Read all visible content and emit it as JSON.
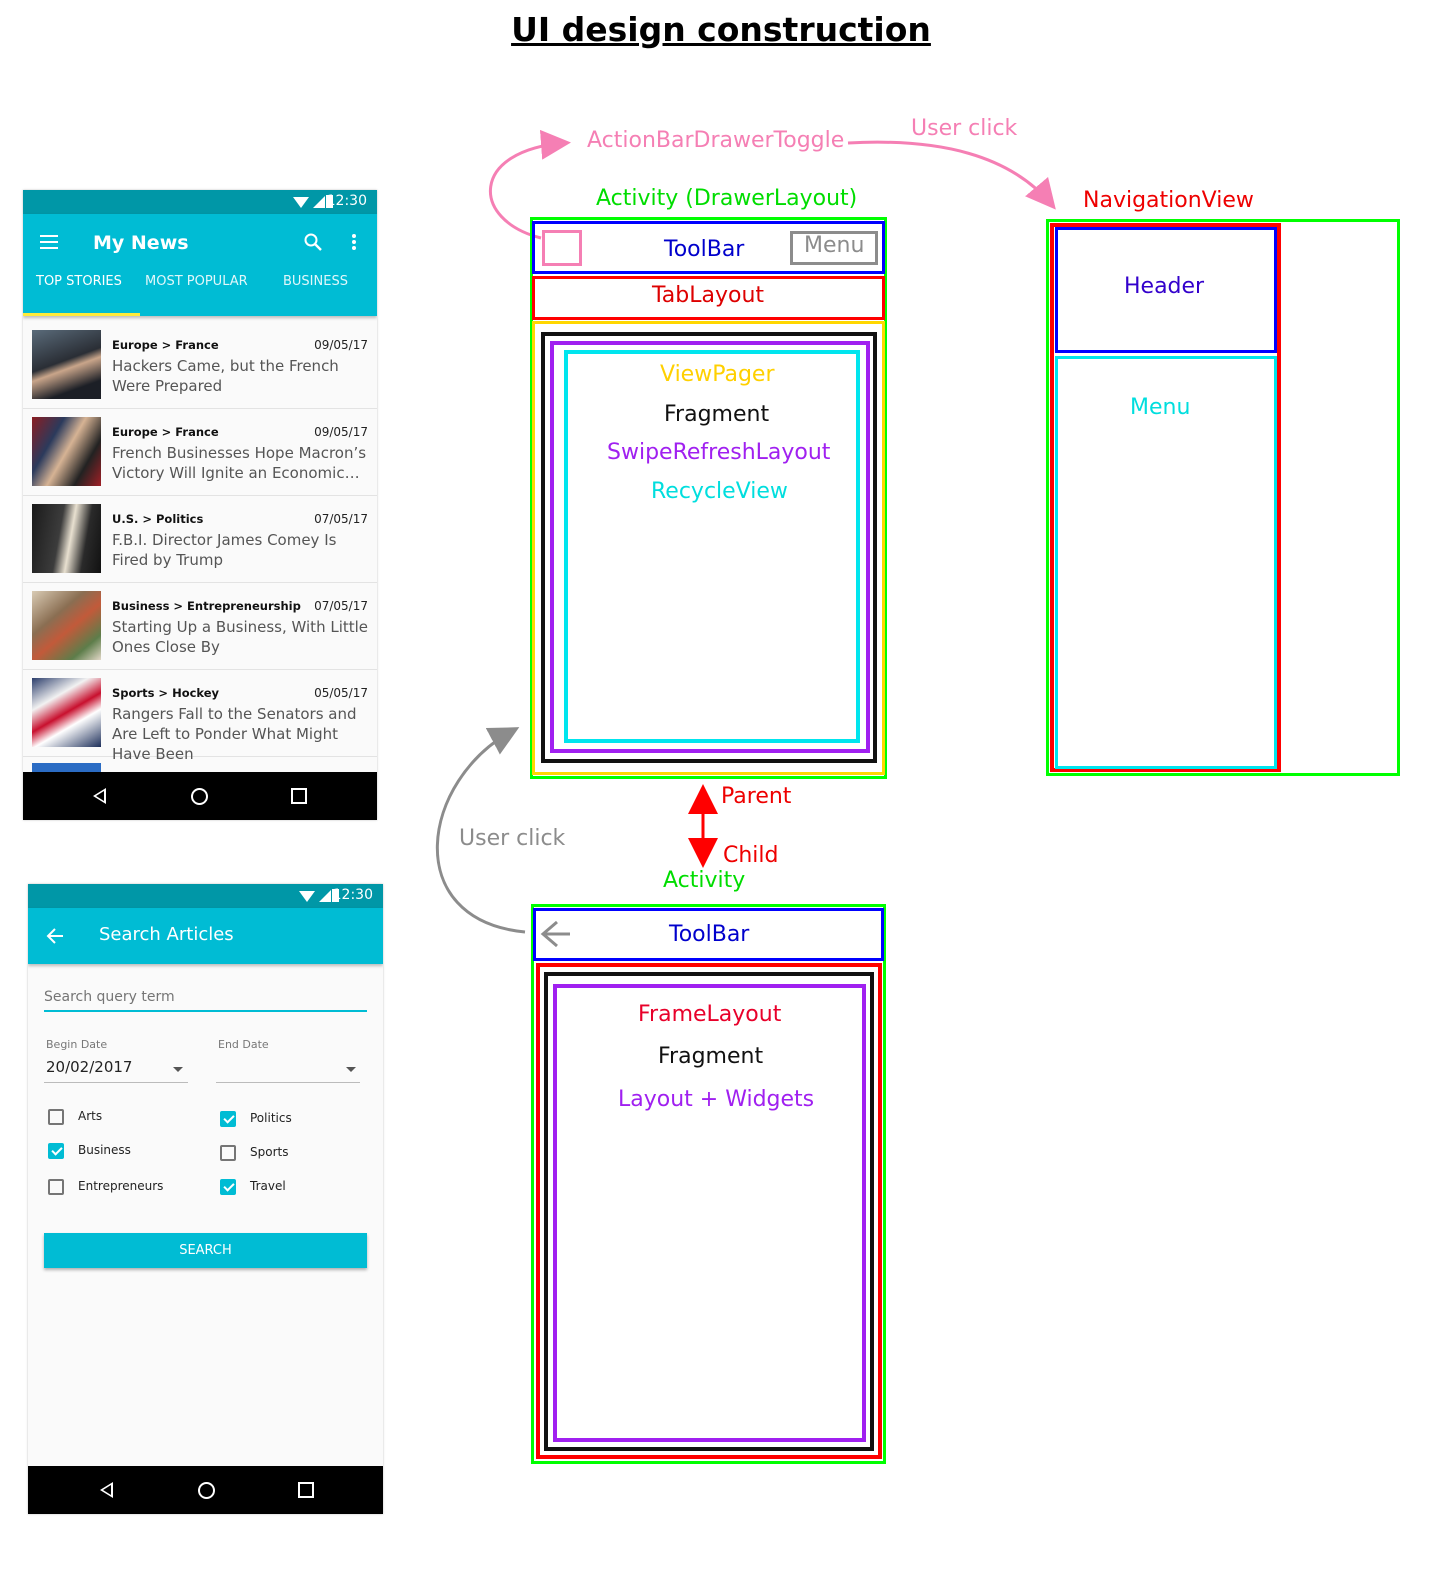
{
  "title": "UI design construction",
  "colors": {
    "toolbar": "#00bcd4",
    "status": "#0097a7",
    "green": "#00ff00",
    "red": "#ff0000",
    "blue": "#0000ff",
    "yellow": "#ffd700",
    "purple": "#a020f0",
    "cyan": "#00e5ee",
    "pink": "#f57fb4",
    "grey": "#8c8c8c"
  },
  "phone_main": {
    "status_time": "12:30",
    "app_title": "My News",
    "tabs": [
      "TOP STORIES",
      "MOST POPULAR",
      "BUSINESS"
    ],
    "stories": [
      {
        "section": "Europe > France",
        "date": "09/05/17",
        "title": "Hackers Came, but the French Were Prepared"
      },
      {
        "section": "Europe > France",
        "date": "09/05/17",
        "title": "French Businesses Hope Macron’s Victory Will Ignite an Economic…"
      },
      {
        "section": "U.S. > Politics",
        "date": "07/05/17",
        "title": "F.B.I. Director James Comey Is Fired by Trump"
      },
      {
        "section": "Business > Entrepreneurship",
        "date": "07/05/17",
        "title": "Starting Up a Business, With Little Ones Close By"
      },
      {
        "section": "Sports > Hockey",
        "date": "05/05/17",
        "title": "Rangers Fall to the Senators and Are Left to Ponder What Might Have Been"
      }
    ]
  },
  "phone_search": {
    "status_time": "12:30",
    "title": "Search Articles",
    "search_placeholder": "Search query term",
    "begin_label": "Begin Date",
    "begin_value": "20/02/2017",
    "end_label": "End Date",
    "end_value": "",
    "checkboxes": [
      {
        "label": "Arts",
        "checked": false
      },
      {
        "label": "Politics",
        "checked": true
      },
      {
        "label": "Business",
        "checked": true
      },
      {
        "label": "Sports",
        "checked": false
      },
      {
        "label": "Entrepreneurs",
        "checked": false
      },
      {
        "label": "Travel",
        "checked": true
      }
    ],
    "search_button": "SEARCH"
  },
  "diagram": {
    "toggle_label": "ActionBarDrawerToggle",
    "user_click_top": "User click",
    "activity_drawer": "Activity (DrawerLayout)",
    "toolbar": "ToolBar",
    "menu": "Menu",
    "tablayout": "TabLayout",
    "viewpager": "ViewPager",
    "fragment": "Fragment",
    "swiperefresh": "SwipeRefreshLayout",
    "recycleview": "RecycleView",
    "parent": "Parent",
    "child": "Child",
    "activity": "Activity",
    "user_click_left": "User click",
    "child_toolbar": "ToolBar",
    "framelayout": "FrameLayout",
    "child_fragment": "Fragment",
    "layout_widgets": "Layout + Widgets",
    "navigationview": "NavigationView",
    "nav_header": "Header",
    "nav_menu": "Menu"
  }
}
